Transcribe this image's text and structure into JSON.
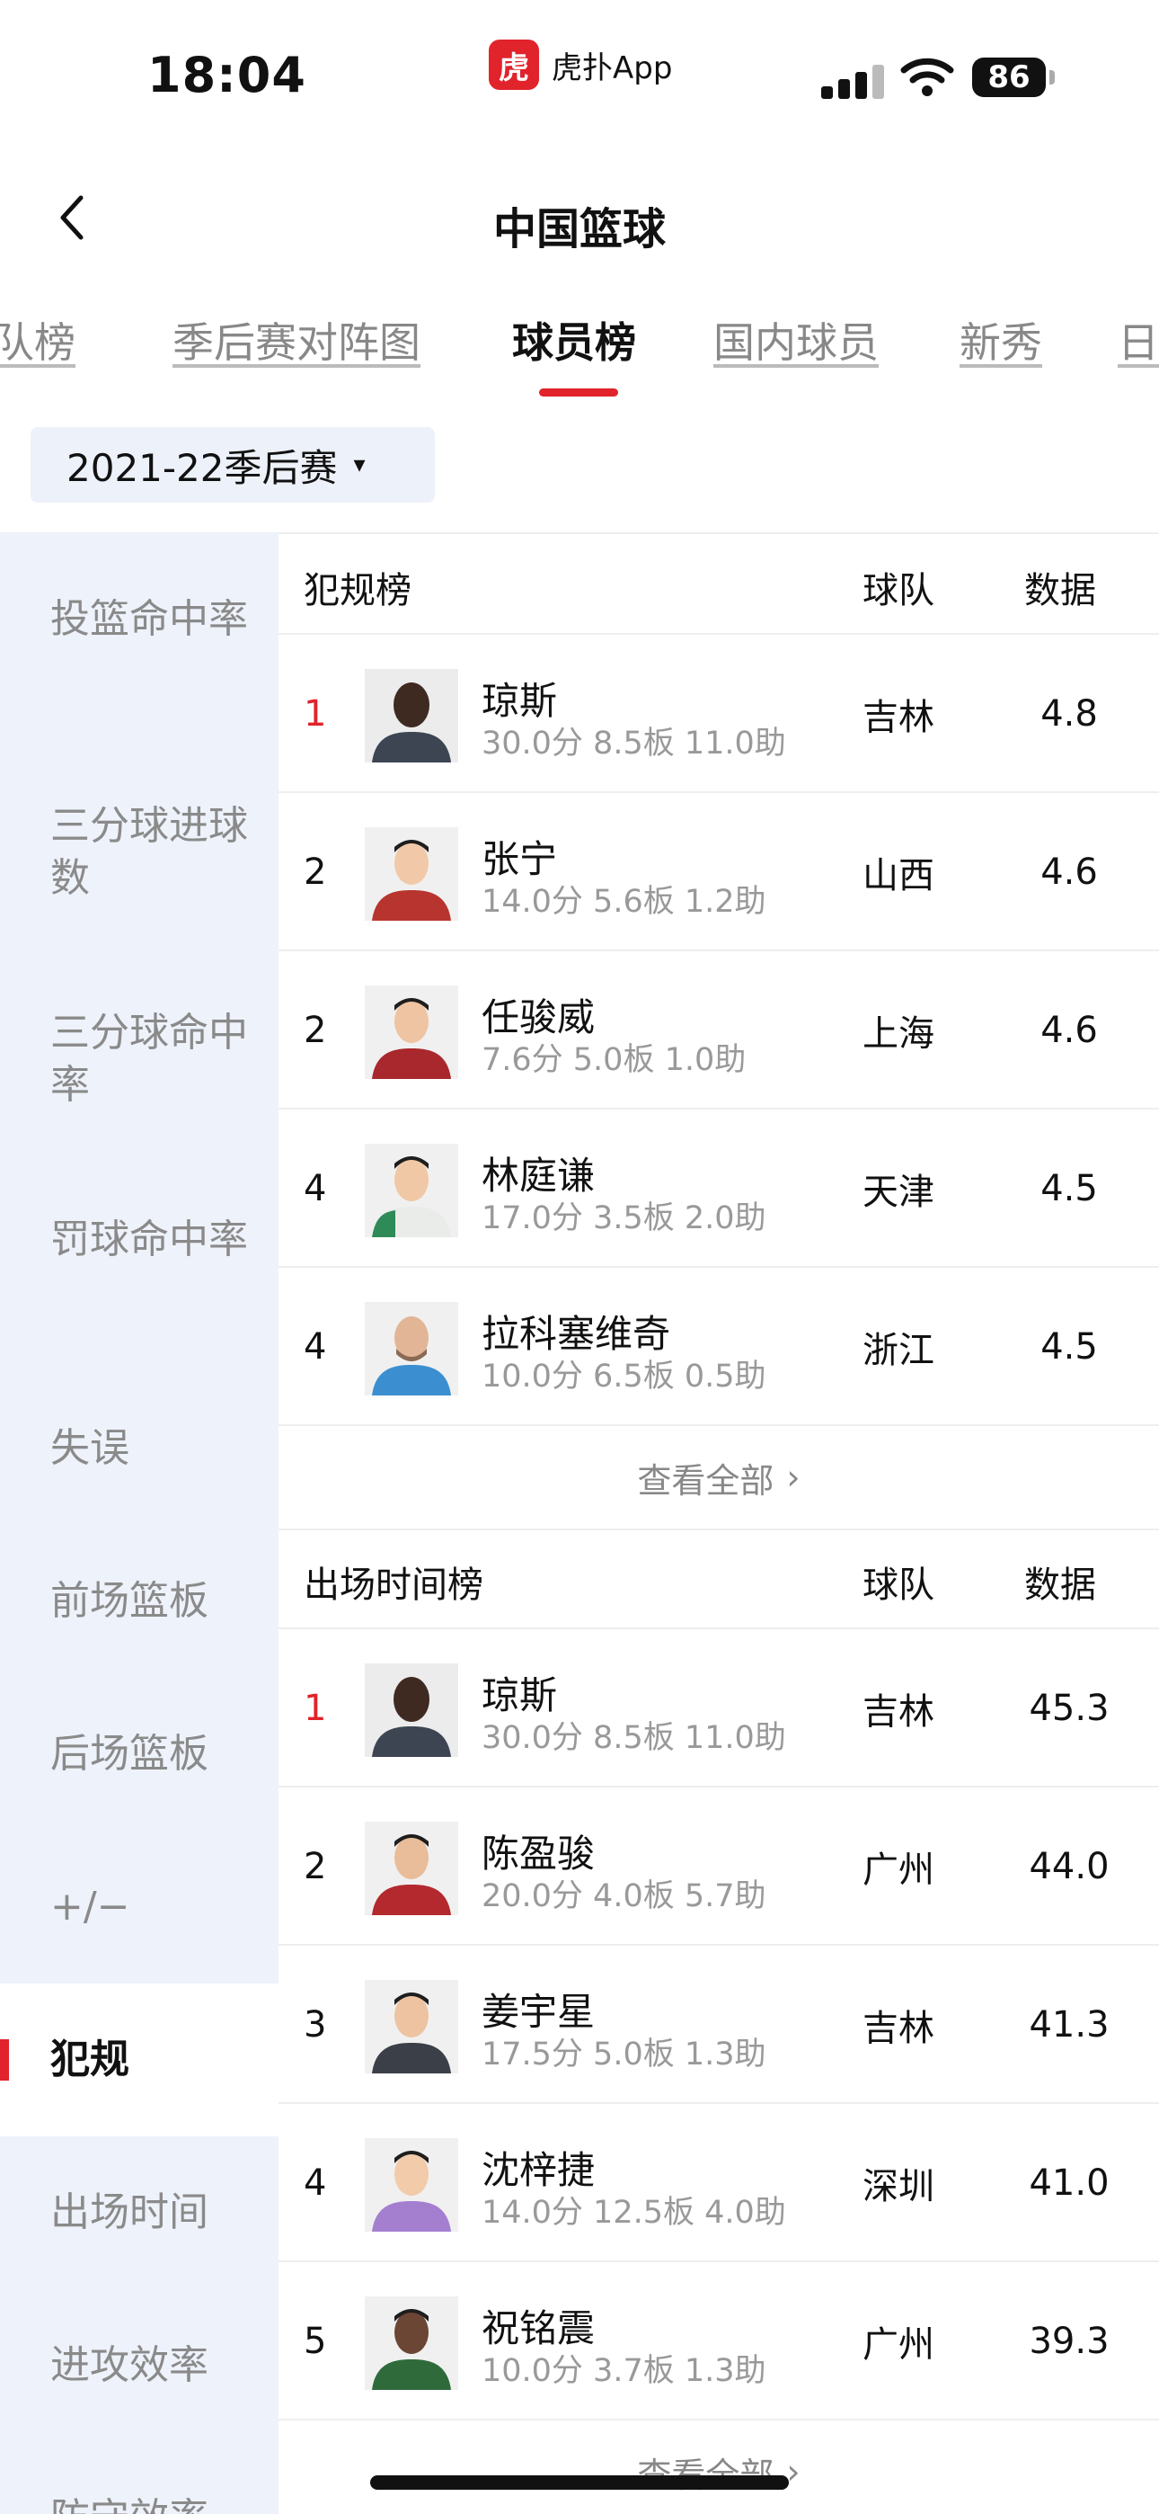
{
  "status_bar": {
    "time": "18:04",
    "app_logo_text": "虎",
    "app_name": "虎扑App",
    "battery": "86"
  },
  "nav": {
    "title": "中国篮球"
  },
  "tabs": [
    "球队榜",
    "季后赛对阵图",
    "球员榜",
    "国内球员",
    "新秀",
    "日"
  ],
  "active_tab": 2,
  "season": {
    "label": "2021-22季后赛",
    "caret": "▾"
  },
  "sidebar": {
    "items": [
      "投篮命中率",
      "三分球进球数",
      "三分球命中率",
      "罚球命中率",
      "失误",
      "前场篮板",
      "后场篮板",
      "+/−",
      "犯规",
      "出场时间",
      "进攻效率",
      "防守效率"
    ],
    "active_index": 8
  },
  "colors": {
    "accent": "#e1232c",
    "sidebar_bg": "#eef2fa",
    "muted_text": "#999999"
  },
  "boards": [
    {
      "title": "犯规榜",
      "team_header": "球队",
      "data_header": "数据",
      "view_all": "查看全部",
      "rows": [
        {
          "rank": "1",
          "name": "琼斯",
          "stats": "30.0分 8.5板 11.0助",
          "team": "吉林",
          "value": "4.8"
        },
        {
          "rank": "2",
          "name": "张宁",
          "stats": "14.0分 5.6板 1.2助",
          "team": "山西",
          "value": "4.6"
        },
        {
          "rank": "2",
          "name": "任骏威",
          "stats": "7.6分 5.0板 1.0助",
          "team": "上海",
          "value": "4.6"
        },
        {
          "rank": "4",
          "name": "林庭谦",
          "stats": "17.0分 3.5板 2.0助",
          "team": "天津",
          "value": "4.5"
        },
        {
          "rank": "4",
          "name": "拉科塞维奇",
          "stats": "10.0分 6.5板 0.5助",
          "team": "浙江",
          "value": "4.5"
        }
      ]
    },
    {
      "title": "出场时间榜",
      "team_header": "球队",
      "data_header": "数据",
      "view_all": "查看全部",
      "rows": [
        {
          "rank": "1",
          "name": "琼斯",
          "stats": "30.0分 8.5板 11.0助",
          "team": "吉林",
          "value": "45.3"
        },
        {
          "rank": "2",
          "name": "陈盈骏",
          "stats": "20.0分 4.0板 5.7助",
          "team": "广州",
          "value": "44.0"
        },
        {
          "rank": "3",
          "name": "姜宇星",
          "stats": "17.5分 5.0板 1.3助",
          "team": "吉林",
          "value": "41.3"
        },
        {
          "rank": "4",
          "name": "沈梓捷",
          "stats": "14.0分 12.5板 4.0助",
          "team": "深圳",
          "value": "41.0"
        },
        {
          "rank": "5",
          "name": "祝铭震",
          "stats": "10.0分 3.7板 1.3助",
          "team": "广州",
          "value": "39.3"
        }
      ]
    }
  ]
}
